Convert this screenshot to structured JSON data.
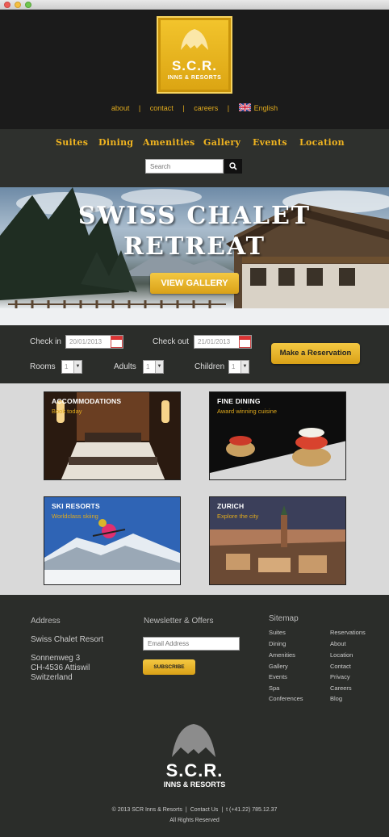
{
  "brand": {
    "name": "S.C.R.",
    "tagline": "INNS & RESORTS",
    "accent": "#f0b420"
  },
  "top_links": {
    "about": "about",
    "contact": "contact",
    "careers": "careers",
    "language": "English",
    "separator": "|"
  },
  "nav": {
    "items": [
      "Suites",
      "Dining",
      "Amenities",
      "Gallery",
      "Events",
      "Location"
    ]
  },
  "search": {
    "placeholder": "Search",
    "icon": "search-icon"
  },
  "hero": {
    "line1": "SWISS CHALET",
    "line2": "RETREAT",
    "button": "VIEW GALLERY"
  },
  "booking": {
    "checkin_label": "Check in",
    "checkin_value": "20/01/2013",
    "checkout_label": "Check out",
    "checkout_value": "21/01/2013",
    "rooms_label": "Rooms",
    "rooms_value": "1",
    "adults_label": "Adults",
    "adults_value": "1",
    "children_label": "Children",
    "children_value": "1",
    "reserve_button": "Make a Reservation"
  },
  "tiles": [
    {
      "title": "ACCOMMODATIONS",
      "subtitle": "Book today"
    },
    {
      "title": "FINE DINING",
      "subtitle": "Award winning cuisine"
    },
    {
      "title": "SKI RESORTS",
      "subtitle": "Worldclass skiing"
    },
    {
      "title": "ZURICH",
      "subtitle": "Explore the city"
    }
  ],
  "footer": {
    "address_heading": "Address",
    "resort_name": "Swiss Chalet Resort",
    "street": "Sonnenweg 3",
    "city": "CH-4536 Attiswil",
    "country": "Switzerland",
    "newsletter_heading": "Newsletter & Offers",
    "email_placeholder": "Email Address",
    "subscribe_button": "SUBSCRIBE",
    "sitemap_heading": "Sitemap",
    "sitemap_col1": [
      "Suites",
      "Dining",
      "Amenities",
      "Gallery",
      "Events",
      "Spa",
      "Conferences"
    ],
    "sitemap_col2": [
      "Reservations",
      "About",
      "Location",
      "Contact",
      "Privacy",
      "Careers",
      "Blog"
    ],
    "copyright": "© 2013 SCR Inns & Resorts",
    "contact_link": "Contact Us",
    "phone": "t (+41.22) 785.12.37",
    "rights": "All Rights Reserved"
  }
}
